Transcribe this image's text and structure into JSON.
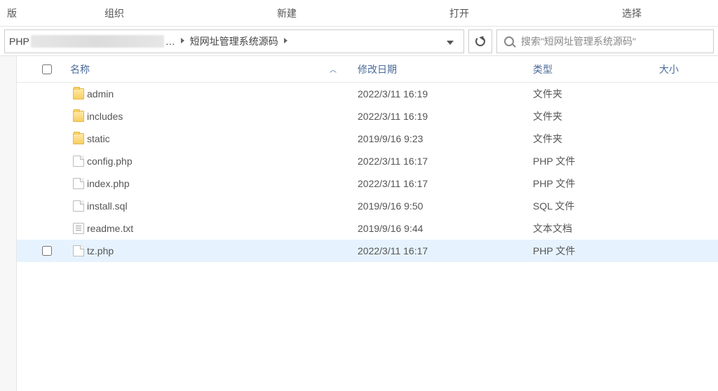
{
  "toolbar": {
    "tab0": "版",
    "tab1": "组织",
    "tab2": "新建",
    "tab3": "打开",
    "tab4": "选择"
  },
  "breadcrumb": {
    "seg0": "PHP",
    "segMid": "… ",
    "seg1": "短网址管理系统源码"
  },
  "search": {
    "placeholder": "搜索\"短网址管理系统源码\""
  },
  "columns": {
    "name": "名称",
    "date": "修改日期",
    "type": "类型",
    "size": "大小"
  },
  "files": [
    {
      "icon": "folder",
      "name": "admin",
      "date": "2022/3/11 16:19",
      "type": "文件夹",
      "selected": false
    },
    {
      "icon": "folder",
      "name": "includes",
      "date": "2022/3/11 16:19",
      "type": "文件夹",
      "selected": false
    },
    {
      "icon": "folder",
      "name": "static",
      "date": "2019/9/16 9:23",
      "type": "文件夹",
      "selected": false
    },
    {
      "icon": "file",
      "name": "config.php",
      "date": "2022/3/11 16:17",
      "type": "PHP 文件",
      "selected": false
    },
    {
      "icon": "file",
      "name": "index.php",
      "date": "2022/3/11 16:17",
      "type": "PHP 文件",
      "selected": false
    },
    {
      "icon": "file",
      "name": "install.sql",
      "date": "2019/9/16 9:50",
      "type": "SQL 文件",
      "selected": false
    },
    {
      "icon": "txt",
      "name": "readme.txt",
      "date": "2019/9/16 9:44",
      "type": "文本文档",
      "selected": false
    },
    {
      "icon": "file",
      "name": "tz.php",
      "date": "2022/3/11 16:17",
      "type": "PHP 文件",
      "selected": true
    }
  ]
}
